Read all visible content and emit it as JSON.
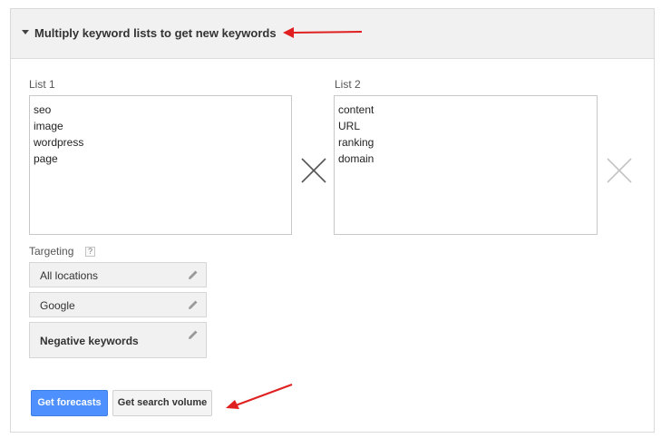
{
  "panel": {
    "title": "Multiply keyword lists to get new keywords"
  },
  "lists": {
    "list1": {
      "label": "List 1",
      "lines": [
        "seo",
        "image",
        "wordpress",
        "page"
      ]
    },
    "list2": {
      "label": "List 2",
      "lines": [
        "content",
        "URL",
        "ranking",
        "domain"
      ]
    }
  },
  "targeting": {
    "label": "Targeting",
    "help": "?",
    "items": [
      {
        "label": "All locations"
      },
      {
        "label": "Google"
      },
      {
        "label": "Negative keywords"
      }
    ]
  },
  "buttons": {
    "forecasts": "Get forecasts",
    "search_volume": "Get search volume"
  },
  "colors": {
    "primary": "#4d90fe",
    "annotation_arrow": "#e02020"
  }
}
